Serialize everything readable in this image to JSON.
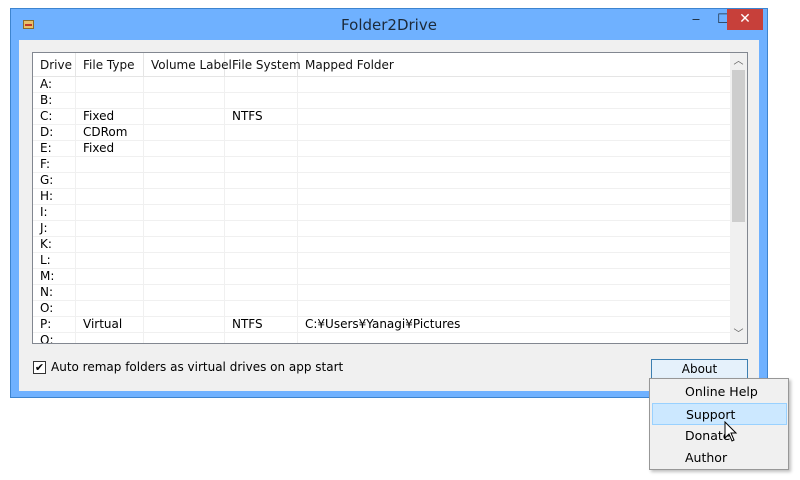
{
  "window": {
    "title": "Folder2Drive",
    "controls": {
      "minimize": "‒",
      "maximize": "☐",
      "close": "✕"
    }
  },
  "list": {
    "columns": [
      "Drive",
      "File Type",
      "Volume Label",
      "File System",
      "Mapped Folder"
    ],
    "rows": [
      [
        "A:",
        "",
        "",
        "",
        ""
      ],
      [
        "B:",
        "",
        "",
        "",
        ""
      ],
      [
        "C:",
        "Fixed",
        "",
        "NTFS",
        ""
      ],
      [
        "D:",
        "CDRom",
        "",
        "",
        ""
      ],
      [
        "E:",
        "Fixed",
        "",
        "",
        ""
      ],
      [
        "F:",
        "",
        "",
        "",
        ""
      ],
      [
        "G:",
        "",
        "",
        "",
        ""
      ],
      [
        "H:",
        "",
        "",
        "",
        ""
      ],
      [
        "I:",
        "",
        "",
        "",
        ""
      ],
      [
        "J:",
        "",
        "",
        "",
        ""
      ],
      [
        "K:",
        "",
        "",
        "",
        ""
      ],
      [
        "L:",
        "",
        "",
        "",
        ""
      ],
      [
        "M:",
        "",
        "",
        "",
        ""
      ],
      [
        "N:",
        "",
        "",
        "",
        ""
      ],
      [
        "O:",
        "",
        "",
        "",
        ""
      ],
      [
        "P:",
        "Virtual",
        "",
        "NTFS",
        "C:¥Users¥Yanagi¥Pictures"
      ],
      [
        "Q:",
        "",
        "",
        "",
        ""
      ]
    ]
  },
  "options": {
    "auto_remap_label": "Auto remap folders as virtual drives on app start",
    "auto_remap_checked": true,
    "check_glyph": "✔"
  },
  "about_button": "About",
  "about_menu": {
    "items": [
      "Online Help",
      "Support",
      "Donate",
      "Author"
    ],
    "highlighted": "Support"
  },
  "colors": {
    "title_bar": "#6fb1ff",
    "close_button": "#c7403a",
    "menu_highlight": "#cce8ff"
  }
}
